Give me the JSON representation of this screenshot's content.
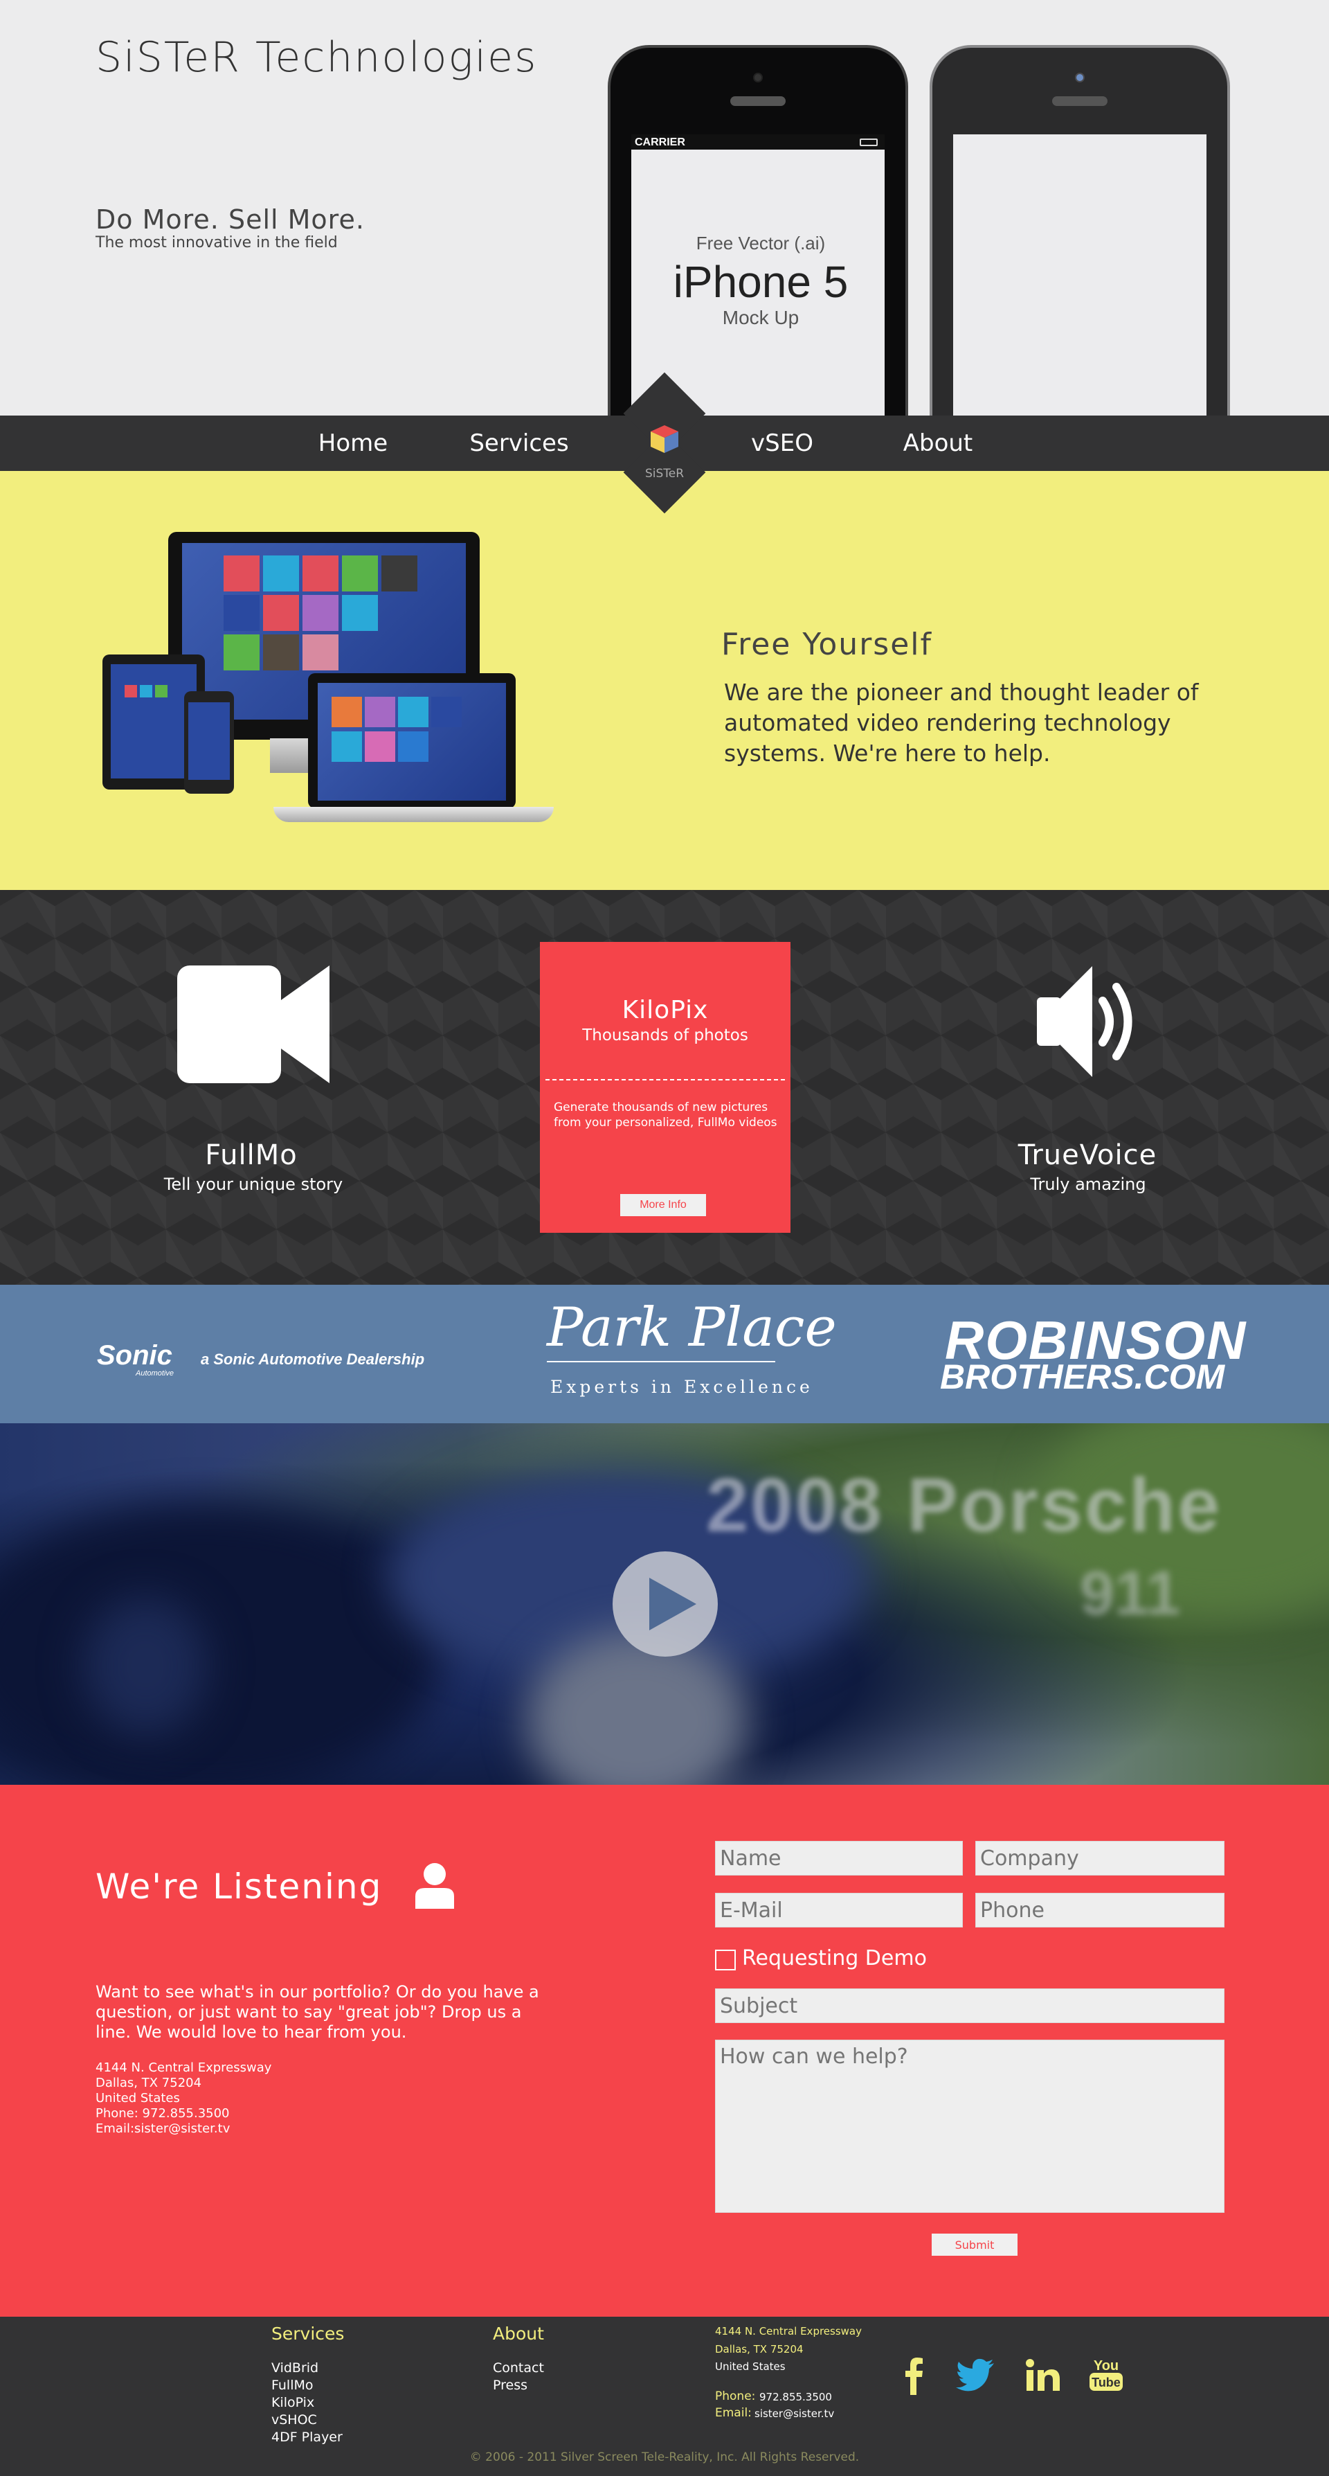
{
  "hero": {
    "brand": "SiSTeR Technologies",
    "tagline": "Do More. Sell More.",
    "subtagline": "The most innovative in the field",
    "phone_carrier": "CARRIER",
    "mockup_line1": "Free Vector (.ai)",
    "mockup_line2": "iPhone 5",
    "mockup_line3": "Mock Up"
  },
  "nav": {
    "items": [
      "Home",
      "Services",
      "vSEO",
      "About"
    ],
    "logo_label": "SiSTeR"
  },
  "intro": {
    "title": "Free Yourself",
    "text": "We are the pioneer and thought leader of automated video rendering technology systems. We're here to help."
  },
  "services": {
    "fullmo_title": "FullMo",
    "fullmo_sub": "Tell your unique story",
    "kilopix_title": "KiloPix",
    "kilopix_sub": "Thousands of photos",
    "kilopix_desc": "Generate thousands of new pictures from your personalized, FullMo videos",
    "kilopix_button": "More Info",
    "truevoice_title": "TrueVoice",
    "truevoice_sub": "Truly amazing"
  },
  "clients": {
    "sonic": "Sonic",
    "sonic_small": "Automotive",
    "sonic_tag": "a Sonic Automotive Dealership",
    "park": "Park Place",
    "park_tag": "Experts in Excellence",
    "robinson_line1": "ROBINSON",
    "robinson_line2": "BROTHERS.COM"
  },
  "video": {
    "overlay_line1": "2008 Porsche",
    "overlay_line2": "911"
  },
  "contact": {
    "title": "We're Listening",
    "text": "Want to see what's in our portfolio? Or do you have a question, or just want to say \"great job\"? Drop us a line. We would love to hear from you.",
    "address": [
      "4144 N. Central Expressway",
      "Dallas, TX 75204",
      "United States",
      "Phone: 972.855.3500",
      "Email:sister@sister.tv"
    ],
    "form": {
      "name_placeholder": "Name",
      "company_placeholder": "Company",
      "email_placeholder": "E-Mail",
      "phone_placeholder": "Phone",
      "demo_label": "Requesting Demo",
      "subject_placeholder": "Subject",
      "message_placeholder": "How can we help?",
      "submit_label": "Submit"
    }
  },
  "footer": {
    "services_heading": "Services",
    "services_links": [
      "VidBrid",
      "FullMo",
      "KiloPix",
      "vSHOC",
      "4DF Player"
    ],
    "about_heading": "About",
    "about_links": [
      "Contact",
      "Press"
    ],
    "address_line1": "4144 N. Central Expressway",
    "address_line2": "Dallas, TX 75204",
    "address_line3": "United States",
    "phone_label": "Phone:",
    "phone_value": "972.855.3500",
    "email_label": "Email:",
    "email_value": "sister@sister.tv",
    "social": [
      "facebook-icon",
      "twitter-icon",
      "linkedin-icon",
      "youtube-icon"
    ],
    "youtube_line1": "You",
    "youtube_line2": "Tube",
    "copyright": "© 2006 - 2011 Silver Screen Tele-Reality, Inc. All Rights Reserved."
  },
  "colors": {
    "accent_red": "#f5444a",
    "accent_yellow": "#f2ee7e",
    "dark": "#333334",
    "steel_blue": "#5e7fa6"
  }
}
